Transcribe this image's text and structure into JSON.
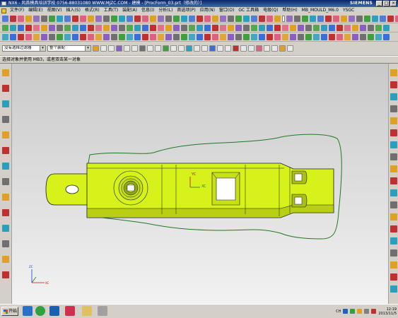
{
  "window": {
    "title": "NX6 - 风首模具培训学校   0756-88031080   WWW.MJZC.COM - 建模 - [ProcForm_03.prt（修改的）]",
    "brand": "SIEMENS"
  },
  "menu": {
    "items": [
      "文件(F)",
      "编辑(E)",
      "视图(V)",
      "插入(S)",
      "格式(R)",
      "工具(T)",
      "装配(A)",
      "信息(I)",
      "分析(L)",
      "首选项(P)",
      "应用(N)",
      "窗口(O)",
      "GC 工具箱",
      "电极(Q)",
      "帮助(H)",
      "MB_MOULD_M6.0",
      "YSGC"
    ]
  },
  "toolbar": {
    "zoom_value": "1",
    "filter_combo": "没有选择过滤器",
    "assembly_combo": "整个装配"
  },
  "cue_line": "选择对象并使用 MB3，或者双击某一对象",
  "icons": {
    "toolbar_palette": [
      "#3a6fd8",
      "#e0a020",
      "#40a040",
      "#c03030",
      "#8a5fc0",
      "#2aa0c0",
      "#e06080",
      "#707070"
    ]
  },
  "model": {
    "body_color": "#d6f21a",
    "boundary_color": "#1f7a1f",
    "triad_labels": {
      "xc": "XC",
      "yc": "YC",
      "zc": "ZC"
    }
  },
  "taskbar": {
    "start_label": "开始",
    "lang": "CH",
    "time": "12:19",
    "date": "2013/11/5"
  }
}
